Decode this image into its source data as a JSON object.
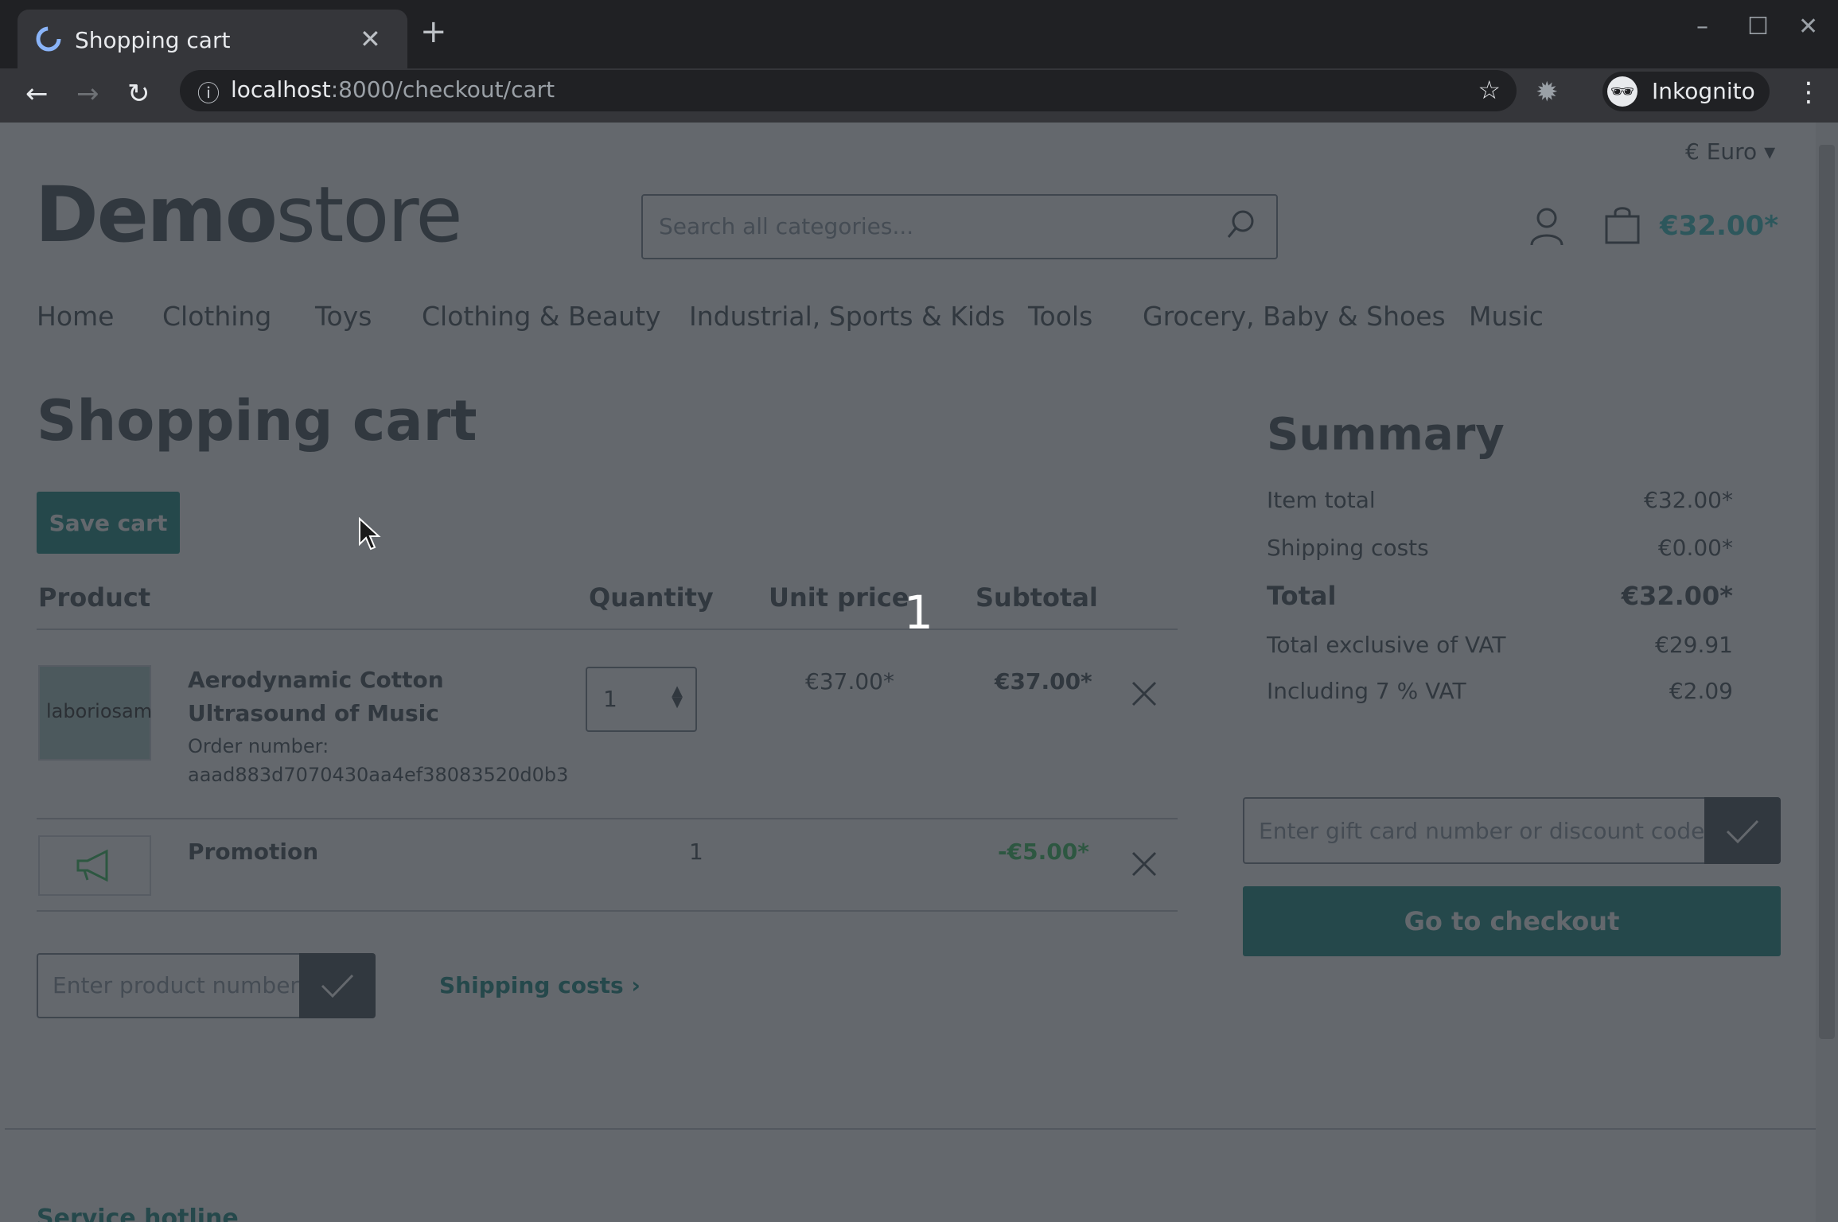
{
  "browser": {
    "tab_title": "Shopping cart",
    "url_host": "localhost",
    "url_rest": ":8000/checkout/cart",
    "profile_label": "Inkognito"
  },
  "header": {
    "currency": "€ Euro",
    "logo_bold": "Demo",
    "logo_light": "store",
    "search_placeholder": "Search all categories...",
    "cart_total": "€32.00*"
  },
  "nav": {
    "items": [
      "Home",
      "Clothing",
      "Toys",
      "Clothing & Beauty",
      "Industrial, Sports & Kids",
      "Tools",
      "Grocery, Baby & Shoes",
      "Music"
    ]
  },
  "cart": {
    "title": "Shopping cart",
    "save_label": "Save cart",
    "columns": {
      "product": "Product",
      "quantity": "Quantity",
      "unit_price": "Unit price",
      "subtotal": "Subtotal"
    },
    "items": [
      {
        "thumb_text": "laboriosam",
        "name": "Aerodynamic Cotton Ultrasound of Music",
        "order_label": "Order number:",
        "order_number": "aaad883d7070430aa4ef38083520d0b3",
        "quantity": "1",
        "unit_price": "€37.00*",
        "subtotal": "€37.00*"
      }
    ],
    "promotion": {
      "name": "Promotion",
      "quantity": "1",
      "subtotal": "-€5.00*"
    },
    "product_number_placeholder": "Enter product number",
    "shipping_link": "Shipping costs"
  },
  "summary": {
    "title": "Summary",
    "rows": [
      {
        "label": "Item total",
        "value": "€32.00*"
      },
      {
        "label": "Shipping costs",
        "value": "€0.00*"
      },
      {
        "label": "Total",
        "value": "€32.00*"
      },
      {
        "label": "Total exclusive of VAT",
        "value": "€29.91"
      },
      {
        "label": "Including 7 % VAT",
        "value": "€2.09"
      }
    ],
    "gift_placeholder": "Enter gift card number or discount code...",
    "checkout_label": "Go to checkout"
  },
  "footer": {
    "service_hotline": "Service hotline"
  },
  "overlay_badge": "1",
  "colors": {
    "brand": "#1d8b85",
    "accent": "#3cc3c0",
    "promo": "#3cc261",
    "text": "#4a545b"
  }
}
